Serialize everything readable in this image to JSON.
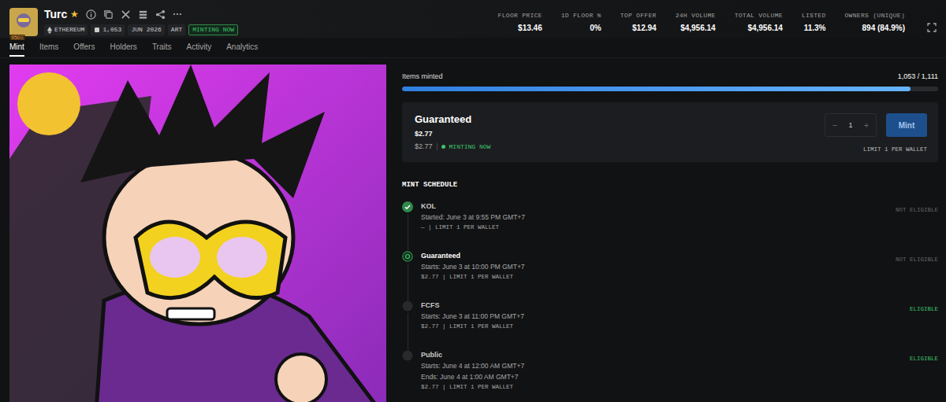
{
  "collection": {
    "name": "Turc",
    "starred": true,
    "star": "★",
    "logo_badge": "950Ξ",
    "more": "···",
    "badges": [
      {
        "label": "ETHEREUM",
        "kind": "chain"
      },
      {
        "label": "1,053",
        "kind": "items"
      },
      {
        "label": "JUN 2026",
        "kind": "plain"
      },
      {
        "label": "ART",
        "kind": "plain"
      },
      {
        "label": "MINTING NOW",
        "kind": "status"
      }
    ]
  },
  "stats": [
    {
      "label": "FLOOR PRICE",
      "value": "$13.46"
    },
    {
      "label": "1D FLOOR %",
      "value": "0%"
    },
    {
      "label": "TOP OFFER",
      "value": "$12.94"
    },
    {
      "label": "24H VOLUME",
      "value": "$4,956.14"
    },
    {
      "label": "TOTAL VOLUME",
      "value": "$4,956.14"
    },
    {
      "label": "LISTED",
      "value": "11.3%"
    },
    {
      "label": "OWNERS (UNIQUE)",
      "value": "894 (84.9%)"
    }
  ],
  "tabs": [
    {
      "label": "Mint",
      "selected": true
    },
    {
      "label": "Items",
      "selected": false
    },
    {
      "label": "Offers",
      "selected": false
    },
    {
      "label": "Holders",
      "selected": false
    },
    {
      "label": "Traits",
      "selected": false
    },
    {
      "label": "Activity",
      "selected": false
    },
    {
      "label": "Analytics",
      "selected": false
    }
  ],
  "mint": {
    "label": "Items minted",
    "count": "1,053 / 1,111",
    "level": 0.948
  },
  "phase_card": {
    "name": "Guaranteed",
    "price": "$2.77",
    "sub_price": "$2.77",
    "status": "MINTING NOW",
    "minus": "−",
    "quantity": "1",
    "plus": "+",
    "button": "Mint",
    "limit": "LIMIT 1 PER WALLET"
  },
  "schedule": {
    "title": "MINT SCHEDULE",
    "phases": [
      {
        "name": "KOL",
        "state": "done",
        "lines": [
          "Started: June 3 at 9:55 PM GMT+7"
        ],
        "terms": "— | LIMIT 1 PER WALLET",
        "eligibility": "NOT ELIGIBLE",
        "eligible": false
      },
      {
        "name": "Guaranteed",
        "state": "active",
        "lines": [
          "Starts: June 3 at 10:00 PM GMT+7"
        ],
        "terms": "$2.77 | LIMIT 1 PER WALLET",
        "eligibility": "NOT ELIGIBLE",
        "eligible": false
      },
      {
        "name": "FCFS",
        "state": "pending",
        "lines": [
          "Starts: June 3 at 11:00 PM GMT+7"
        ],
        "terms": "$2.77 | LIMIT 1 PER WALLET",
        "eligibility": "ELIGIBLE",
        "eligible": true
      },
      {
        "name": "Public",
        "state": "pending",
        "lines": [
          "Starts: June 4 at 12:00 AM GMT+7",
          "Ends: June 4 at 1:00 AM GMT+7"
        ],
        "terms": "$2.77 | LIMIT 1 PER WALLET",
        "eligibility": "ELIGIBLE",
        "eligible": true
      }
    ]
  }
}
